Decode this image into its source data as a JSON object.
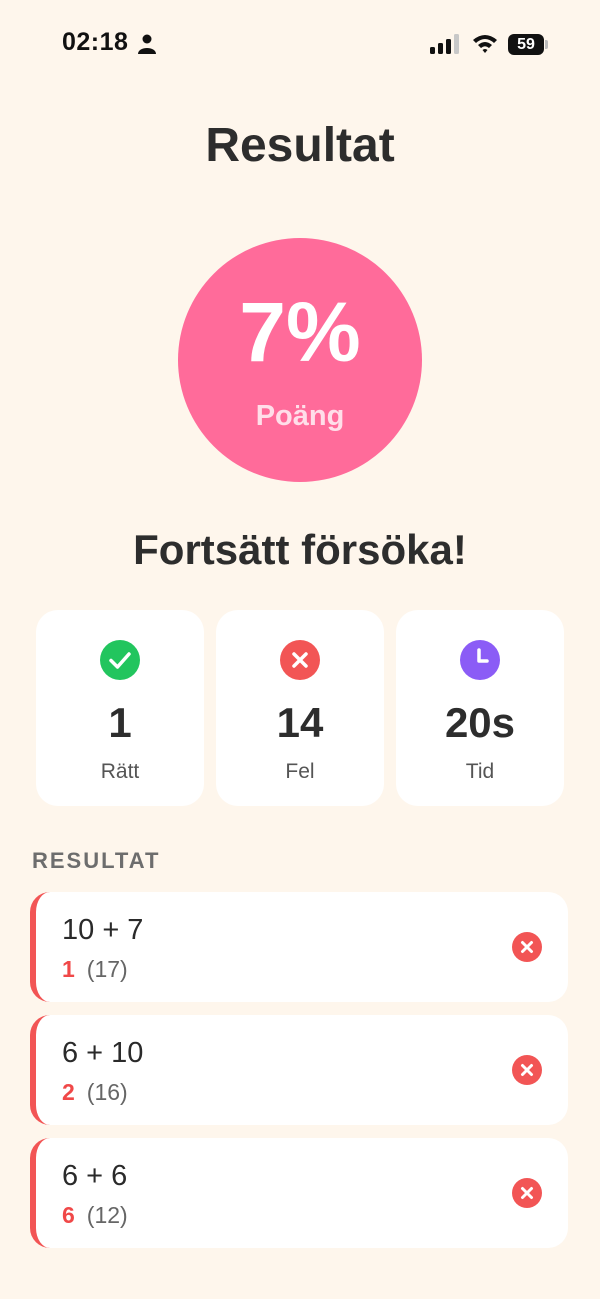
{
  "status_bar": {
    "time": "02:18",
    "battery": "59"
  },
  "title": "Resultat",
  "score": {
    "value": "7%",
    "label": "Poäng",
    "color": "#FF6B9A"
  },
  "encouragement": "Fortsätt försöka!",
  "stats": [
    {
      "value": "1",
      "label": "Rätt",
      "icon": "check-circle-icon",
      "color": "#22C55E"
    },
    {
      "value": "14",
      "label": "Fel",
      "icon": "x-circle-icon",
      "color": "#F25555"
    },
    {
      "value": "20s",
      "label": "Tid",
      "icon": "clock-icon",
      "color": "#8B5CF6"
    }
  ],
  "results_section": {
    "label": "RESULTAT",
    "items": [
      {
        "question": "10 + 7",
        "given": "1",
        "correct": "(17)",
        "status": "wrong"
      },
      {
        "question": "6 + 10",
        "given": "2",
        "correct": "(16)",
        "status": "wrong"
      },
      {
        "question": "6 + 6",
        "given": "6",
        "correct": "(12)",
        "status": "wrong"
      }
    ]
  },
  "colors": {
    "background": "#FEF6EC",
    "wrong": "#F25555",
    "correct": "#22C55E",
    "time": "#8B5CF6"
  }
}
